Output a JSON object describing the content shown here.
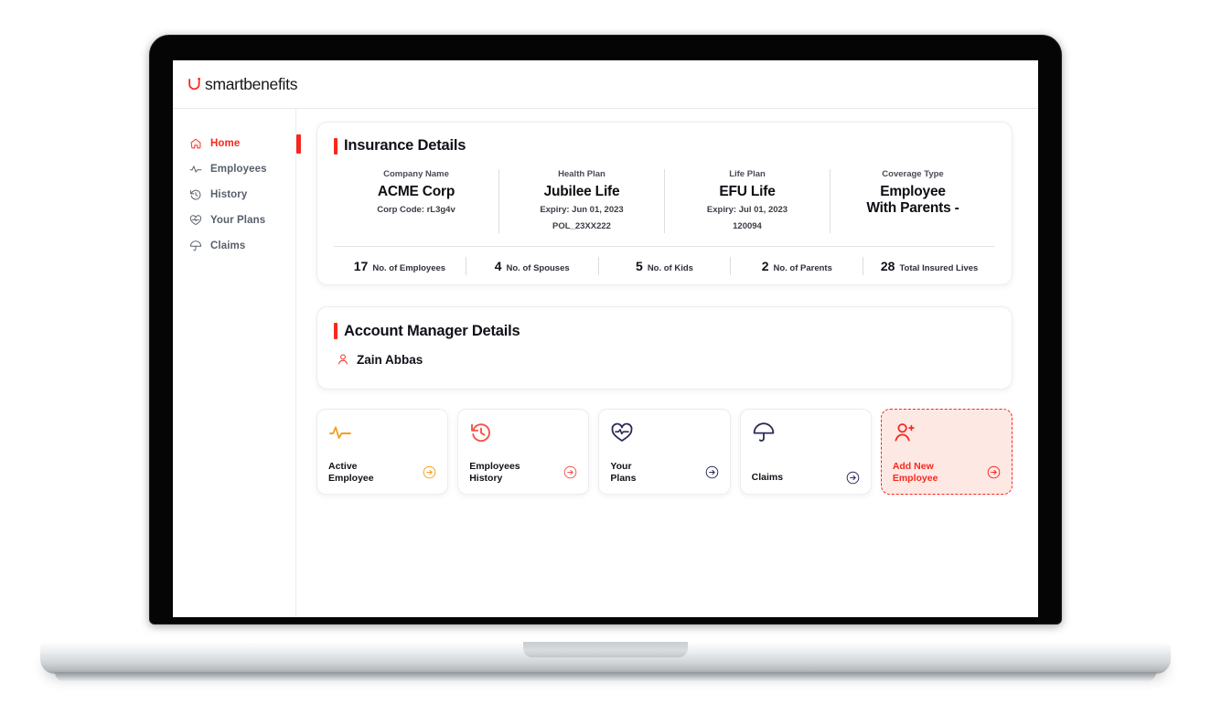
{
  "brand": {
    "name": "smartbenefits",
    "logo_icon": "horseshoe-u-mark",
    "accent_red": "#f8281e",
    "accent_orange": "#f6a01f",
    "accent_navy": "#2a2a5a"
  },
  "sidebar": {
    "items": [
      {
        "label": "Home",
        "icon": "home-icon",
        "active": true
      },
      {
        "label": "Employees",
        "icon": "activity-icon",
        "active": false
      },
      {
        "label": "History",
        "icon": "clock-back-icon",
        "active": false
      },
      {
        "label": "Your Plans",
        "icon": "heart-pulse-icon",
        "active": false
      },
      {
        "label": "Claims",
        "icon": "umbrella-icon",
        "active": false
      }
    ]
  },
  "insurance": {
    "title": "Insurance Details",
    "columns": [
      {
        "label": "Company Name",
        "value": "ACME Corp",
        "sub1": "Corp Code: rL3g4v",
        "sub2": ""
      },
      {
        "label": "Health Plan",
        "value": "Jubilee Life",
        "sub1": "Expiry: Jun 01, 2023",
        "sub2": "POL_23XX222"
      },
      {
        "label": "Life Plan",
        "value": "EFU Life",
        "sub1": "Expiry: Jul 01, 2023",
        "sub2": "120094"
      },
      {
        "label": "Coverage Type",
        "value": "Employee\nWith Parents -",
        "sub1": "",
        "sub2": ""
      }
    ],
    "stats": [
      {
        "number": "17",
        "label": "No. of Employees"
      },
      {
        "number": "4",
        "label": "No. of Spouses"
      },
      {
        "number": "5",
        "label": "No. of Kids"
      },
      {
        "number": "2",
        "label": "No. of Parents"
      },
      {
        "number": "28",
        "label": "Total Insured Lives"
      }
    ]
  },
  "account_manager": {
    "title": "Account Manager Details",
    "person_icon": "user-icon",
    "person_name": "Zain Abbas"
  },
  "tiles": [
    {
      "label": "Active\nEmployee",
      "icon": "activity-icon",
      "color": "#f6a01f",
      "highlight": false
    },
    {
      "label": "Employees\nHistory",
      "icon": "clock-back-icon",
      "color": "#f4554a",
      "highlight": false
    },
    {
      "label": "Your\nPlans",
      "icon": "heart-pulse-icon",
      "color": "#2a2a5a",
      "highlight": false
    },
    {
      "label": "Claims",
      "icon": "umbrella-icon",
      "color": "#2a2a5a",
      "highlight": false
    },
    {
      "label": "Add New\nEmployee",
      "icon": "user-plus-icon",
      "color": "#f8281e",
      "highlight": true
    }
  ]
}
